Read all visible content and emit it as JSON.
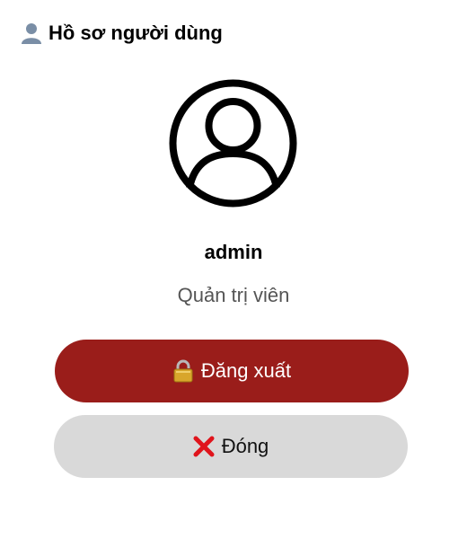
{
  "header": {
    "icon": "user-bust-icon",
    "title": "Hồ sơ người dùng"
  },
  "profile": {
    "avatar_icon": "user-circle-icon",
    "username": "admin",
    "role": "Quản trị viên"
  },
  "buttons": {
    "logout": {
      "icon": "padlock-icon",
      "label": "Đăng xuất",
      "bg_color": "#9a1d1a"
    },
    "close": {
      "icon": "red-cross-icon",
      "label": "Đóng",
      "bg_color": "#d9d9d9"
    }
  }
}
